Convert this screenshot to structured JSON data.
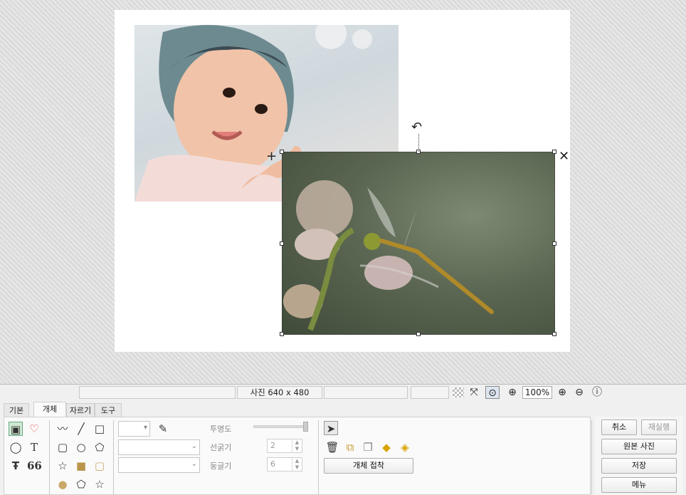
{
  "status": {
    "photo_info": "사진 640 x 480",
    "zoom": "100%"
  },
  "tabs": [
    {
      "label": "기본"
    },
    {
      "label": "개체"
    },
    {
      "label": "자르기"
    },
    {
      "label": "도구"
    }
  ],
  "properties": {
    "opacity_label": "투명도",
    "line_width_label": "선굵기",
    "line_width_value": "2",
    "roundness_label": "둥글기",
    "roundness_value": "6"
  },
  "object_panel": {
    "attach_button": "개체 접착"
  },
  "actions": {
    "cancel": "취소",
    "redo": "재실행",
    "original": "원본 사진",
    "save": "저장",
    "menu": "메뉴"
  },
  "icons": {
    "quote": "66",
    "text": "T"
  }
}
